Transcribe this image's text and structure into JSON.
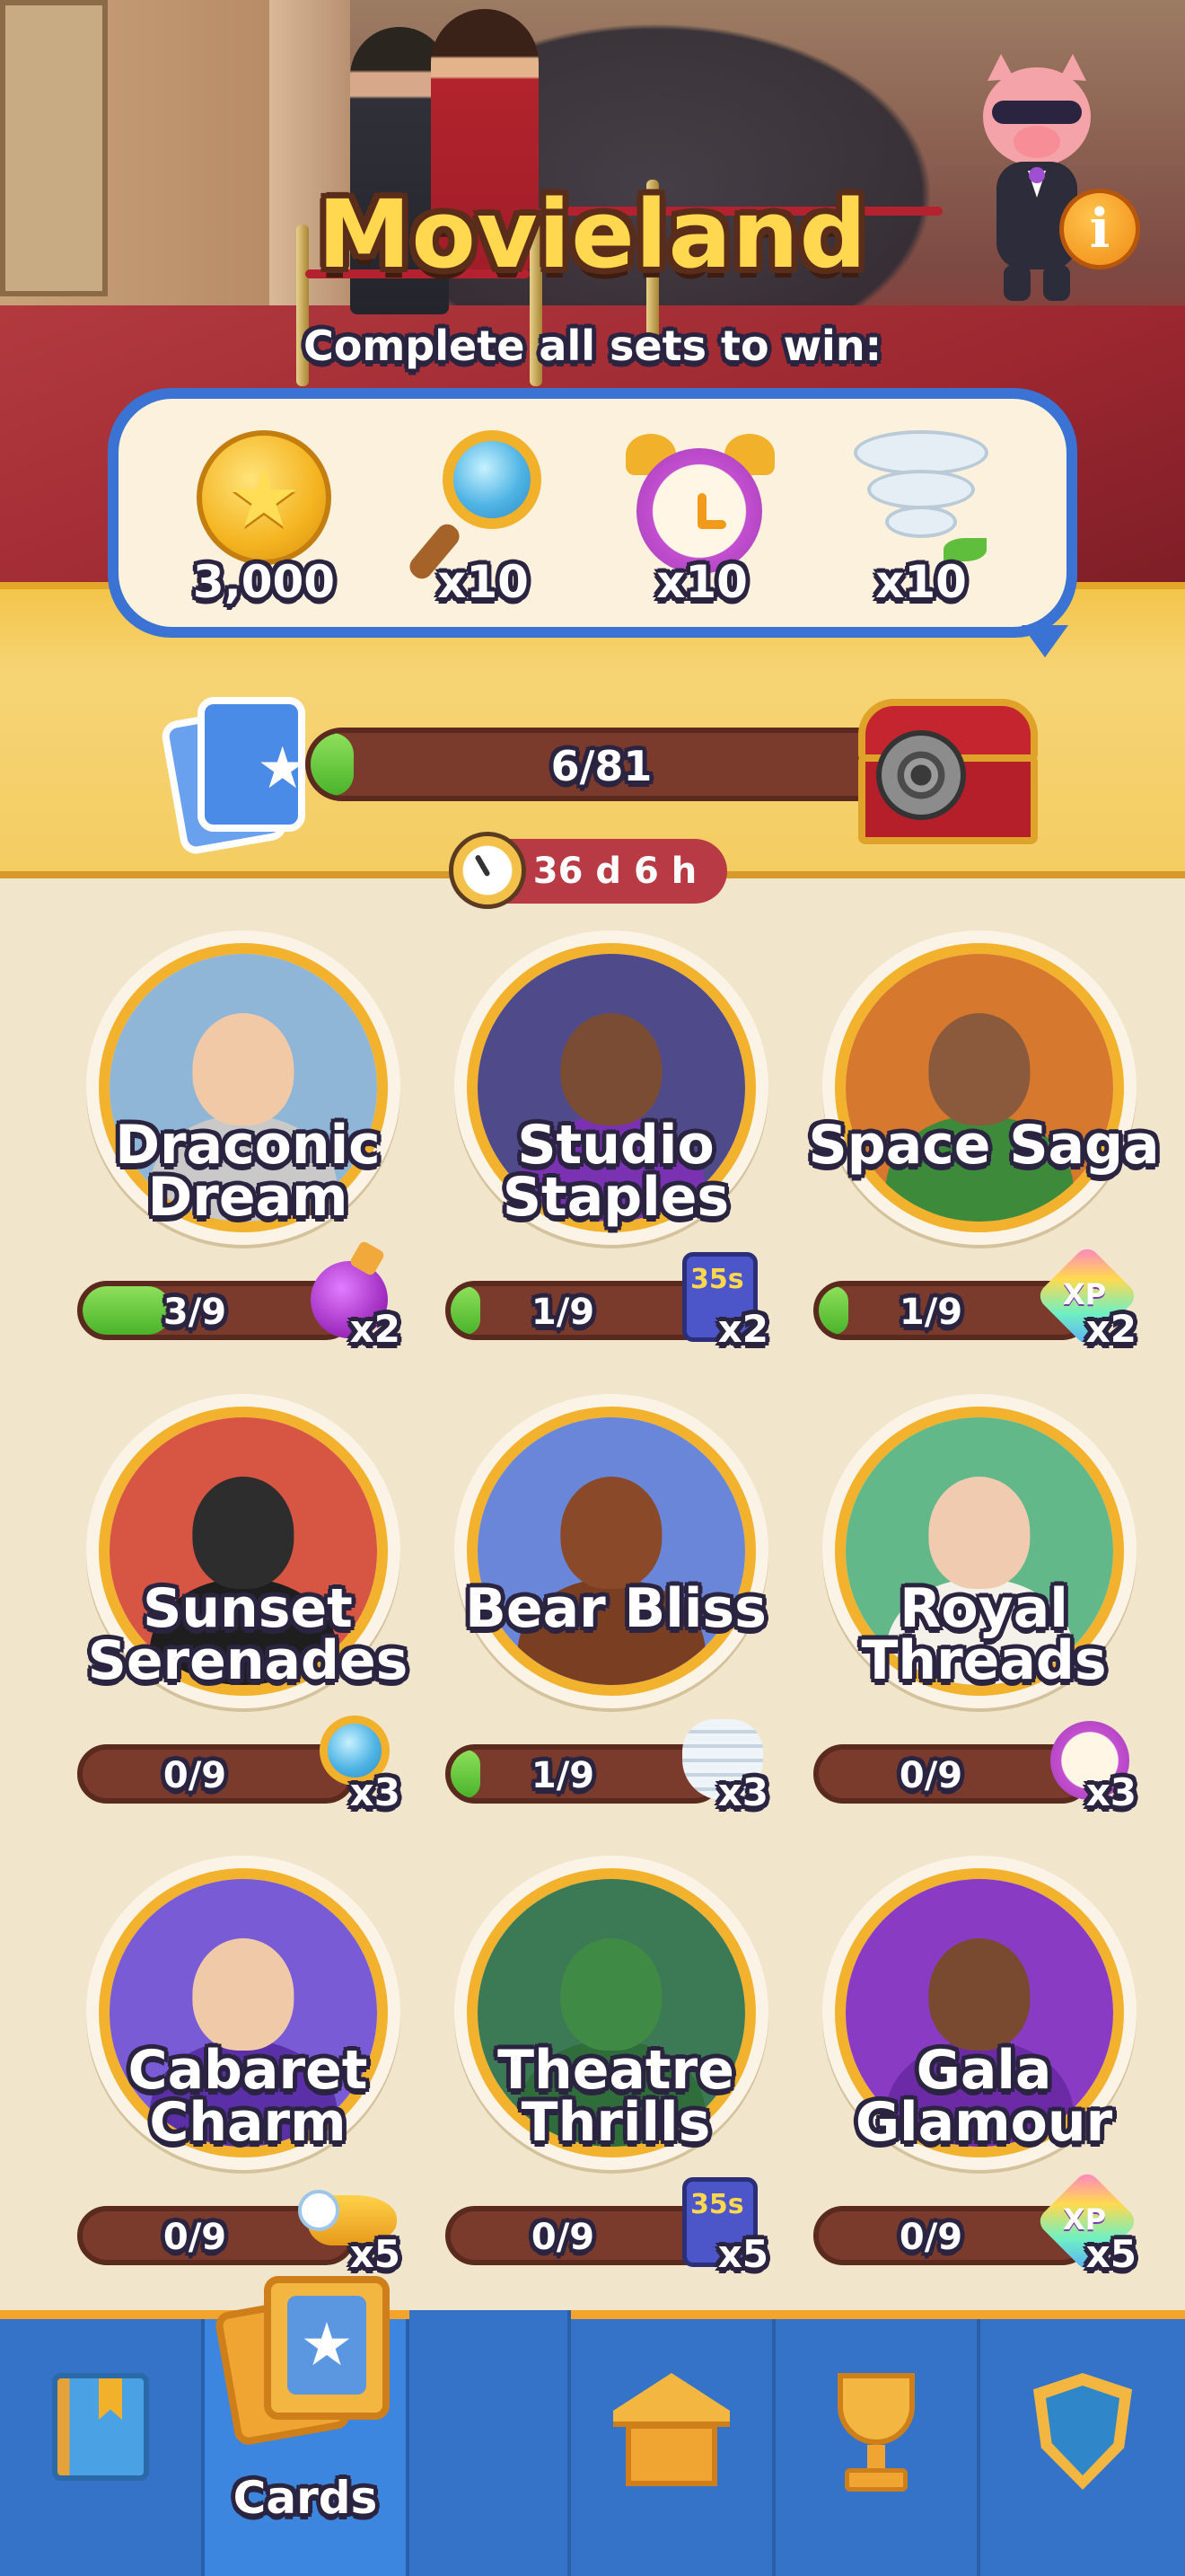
{
  "event": {
    "title": "Movieland",
    "subtitle": "Complete all sets to win:"
  },
  "rewards": [
    {
      "icon": "coin-icon",
      "qty": "3,000"
    },
    {
      "icon": "magnifier-icon",
      "qty": "x10"
    },
    {
      "icon": "alarm-clock-icon",
      "qty": "x10"
    },
    {
      "icon": "tornado-icon",
      "qty": "x10"
    }
  ],
  "progress": {
    "label": "6/81",
    "value": 6,
    "max": 81
  },
  "timer": {
    "label": "36 d 6 h"
  },
  "sets": [
    {
      "name_line1": "Draconic",
      "name_line2": "Dream",
      "count": "3/9",
      "value": 3,
      "max": 9,
      "reward_icon": "potion-icon",
      "multiplier": "x2",
      "bg": "#8fb6d6",
      "skin": "#f2c9a6",
      "top": "#c9c9c9"
    },
    {
      "name_line1": "Studio",
      "name_line2": "Staples",
      "count": "1/9",
      "value": 1,
      "max": 9,
      "reward_icon": "battery-35s-icon",
      "multiplier": "x2",
      "bg": "#4f4b8a",
      "skin": "#7a4c33",
      "top": "#7a32b3"
    },
    {
      "name_line1": "",
      "name_line2": "Space Saga",
      "count": "1/9",
      "value": 1,
      "max": 9,
      "reward_icon": "xp-gem-icon",
      "multiplier": "x2",
      "bg": "#d6782e",
      "skin": "#8b5a3c",
      "top": "#3d8a3a"
    },
    {
      "name_line1": "Sunset",
      "name_line2": "Serenades",
      "count": "0/9",
      "value": 0,
      "max": 9,
      "reward_icon": "magnifier-icon",
      "multiplier": "x3",
      "bg": "#d65543",
      "skin": "#2d2d2d",
      "top": "#1e1e1e"
    },
    {
      "name_line1": "",
      "name_line2": "Bear Bliss",
      "count": "1/9",
      "value": 1,
      "max": 9,
      "reward_icon": "tornado-icon",
      "multiplier": "x3",
      "bg": "#6a86d8",
      "skin": "#8a4a2a",
      "top": "#7a3f22"
    },
    {
      "name_line1": "Royal",
      "name_line2": "Threads",
      "count": "0/9",
      "value": 0,
      "max": 9,
      "reward_icon": "alarm-clock-icon",
      "multiplier": "x3",
      "bg": "#63b88a",
      "skin": "#f0cbb0",
      "top": "#f4f0ea"
    },
    {
      "name_line1": "Cabaret",
      "name_line2": "Charm",
      "count": "0/9",
      "value": 0,
      "max": 9,
      "reward_icon": "rocket-icon",
      "multiplier": "x5",
      "bg": "#7a5bd6",
      "skin": "#f0c9a8",
      "top": "#5b2fa8"
    },
    {
      "name_line1": "Theatre",
      "name_line2": "Thrills",
      "count": "0/9",
      "value": 0,
      "max": 9,
      "reward_icon": "battery-35s-icon",
      "multiplier": "x5",
      "bg": "#3b7a55",
      "skin": "#3f8a45",
      "top": "#2f6e3a"
    },
    {
      "name_line1": "Gala",
      "name_line2": "Glamour",
      "count": "0/9",
      "value": 0,
      "max": 9,
      "reward_icon": "xp-gem-icon",
      "multiplier": "x5",
      "bg": "#8a3bc4",
      "skin": "#7a4a30",
      "top": "#6d2aa6"
    }
  ],
  "xp_text": "XP",
  "nav": {
    "tabs": [
      {
        "icon": "album-book-icon",
        "label": ""
      },
      {
        "icon": "cards-icon",
        "label": "Cards",
        "active": true
      },
      {
        "icon": "home-icon",
        "label": ""
      },
      {
        "icon": "trophy-icon",
        "label": ""
      },
      {
        "icon": "shield-icon",
        "label": ""
      }
    ]
  }
}
